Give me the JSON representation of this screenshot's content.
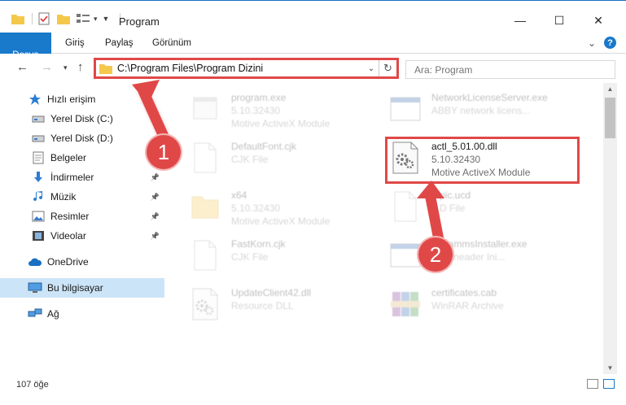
{
  "window": {
    "title": "Program",
    "minimize": "—",
    "maximize": "☐",
    "close": "✕"
  },
  "ribbon": {
    "tabs": [
      "Dosya",
      "Giriş",
      "Paylaş",
      "Görünüm"
    ],
    "expand": "⌄",
    "help": "?"
  },
  "address": {
    "path": "C:\\Program Files\\Program Dizini",
    "dropdown": "⌄",
    "refresh": "↻"
  },
  "search": {
    "placeholder": "Ara: Program"
  },
  "sidebar": {
    "items": [
      {
        "label": "Hızlı erişim",
        "icon": "star-icon",
        "pinned": false
      },
      {
        "label": "Yerel Disk (C:)",
        "icon": "drive-icon",
        "pinned": true
      },
      {
        "label": "Yerel Disk (D:)",
        "icon": "drive-icon",
        "pinned": false
      },
      {
        "label": "Belgeler",
        "icon": "document-icon",
        "pinned": true
      },
      {
        "label": "İndirmeler",
        "icon": "download-icon",
        "pinned": true
      },
      {
        "label": "Müzik",
        "icon": "music-icon",
        "pinned": true
      },
      {
        "label": "Resimler",
        "icon": "pictures-icon",
        "pinned": true
      },
      {
        "label": "Videolar",
        "icon": "video-icon",
        "pinned": true
      },
      {
        "label": "OneDrive",
        "icon": "cloud-icon",
        "pinned": false
      },
      {
        "label": "Bu bilgisayar",
        "icon": "computer-icon",
        "pinned": false,
        "selected": true
      },
      {
        "label": "Ağ",
        "icon": "network-icon",
        "pinned": false
      }
    ]
  },
  "files": [
    {
      "name": "program.exe",
      "sub1": "5.10.32430",
      "sub2": "Motive ActiveX Module",
      "icon": "exe-icon"
    },
    {
      "name": "NetworkLicenseServer.exe",
      "sub1": "ABBY network licens...",
      "sub2": "",
      "icon": "window-icon"
    },
    {
      "name": "DefaultFont.cjk",
      "sub1": "CJK File",
      "sub2": "",
      "icon": "blank-file-icon"
    },
    {
      "name": "actl_5.01.00.dll",
      "sub1": "5.10.32430",
      "sub2": "Motive ActiveX Module",
      "icon": "dll-gear-icon"
    },
    {
      "name": "x64",
      "sub1": "5.10.32430",
      "sub2": "Motive ActiveX Module",
      "icon": "folder-icon"
    },
    {
      "name": "...pic.ucd",
      "sub1": "...D File",
      "sub2": "",
      "icon": "blank-file-icon"
    },
    {
      "name": "FastKorn.cjk",
      "sub1": "CJK File",
      "sub2": "",
      "icon": "blank-file-icon"
    },
    {
      "name": "...grammsInstaller.exe",
      "sub1": "...Y fineader Ini...",
      "sub2": "",
      "icon": "window-icon"
    },
    {
      "name": "UpdateClient42.dll",
      "sub1": "Resource DLL",
      "sub2": "",
      "icon": "dll-gear-icon"
    },
    {
      "name": "certificates.cab",
      "sub1": "WinRAR Archive",
      "sub2": "",
      "icon": "archive-icon"
    }
  ],
  "status": {
    "count": "107 öğe"
  },
  "annotations": {
    "step1": "1",
    "step2": "2",
    "color": "#e04848"
  }
}
